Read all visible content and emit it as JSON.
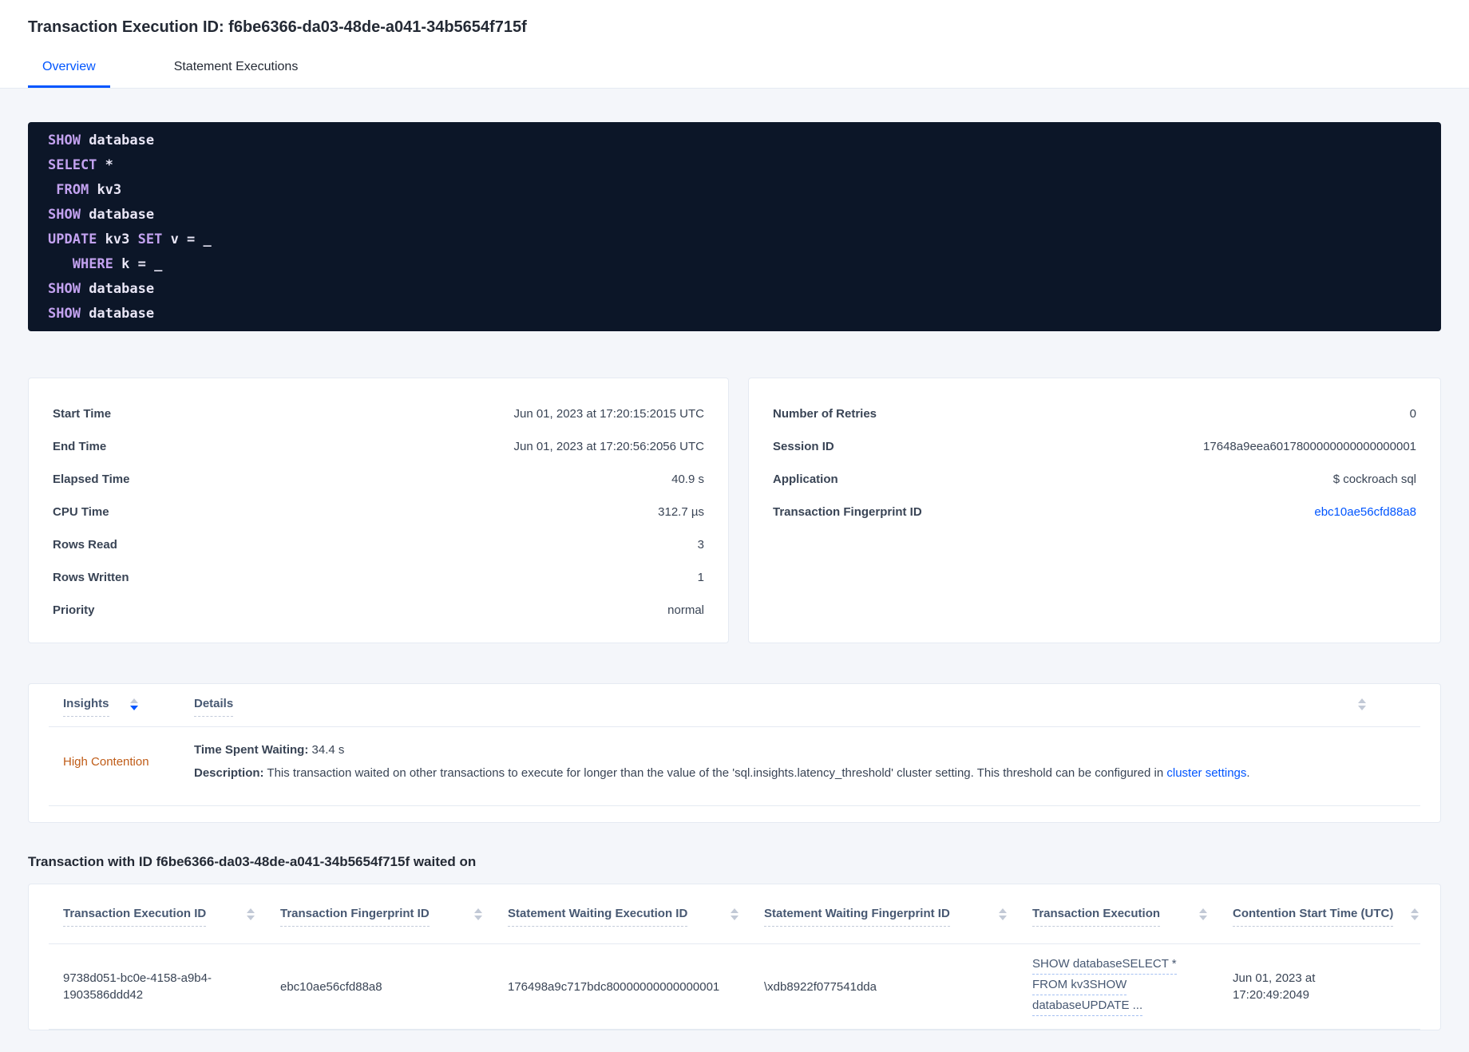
{
  "colors": {
    "accent": "#0055ff",
    "warning": "#bf5b16",
    "code_bg": "#0c1628",
    "kw": "#c3a2f0"
  },
  "page": {
    "title": "Transaction Execution ID: f6be6366-da03-48de-a041-34b5654f715f"
  },
  "tabs": [
    {
      "label": "Overview",
      "active": true
    },
    {
      "label": "Statement Executions",
      "active": false
    }
  ],
  "sql_box": {
    "lines": [
      [
        {
          "k": true,
          "t": "SHOW"
        },
        {
          "k": false,
          "t": " database"
        }
      ],
      [
        {
          "k": true,
          "t": "SELECT"
        },
        {
          "k": false,
          "t": " *"
        }
      ],
      [
        {
          "k": false,
          "t": " "
        },
        {
          "k": true,
          "t": "FROM"
        },
        {
          "k": false,
          "t": " kv3"
        }
      ],
      [
        {
          "k": true,
          "t": "SHOW"
        },
        {
          "k": false,
          "t": " database"
        }
      ],
      [
        {
          "k": true,
          "t": "UPDATE"
        },
        {
          "k": false,
          "t": " kv3 "
        },
        {
          "k": true,
          "t": "SET"
        },
        {
          "k": false,
          "t": " v = _"
        }
      ],
      [
        {
          "k": false,
          "t": "   "
        },
        {
          "k": true,
          "t": "WHERE"
        },
        {
          "k": false,
          "t": " k = _"
        }
      ],
      [
        {
          "k": true,
          "t": "SHOW"
        },
        {
          "k": false,
          "t": " database"
        }
      ],
      [
        {
          "k": true,
          "t": "SHOW"
        },
        {
          "k": false,
          "t": " database"
        }
      ]
    ]
  },
  "details_left": {
    "rows": [
      {
        "label": "Start Time",
        "value": "Jun 01, 2023 at 17:20:15:2015 UTC"
      },
      {
        "label": "End Time",
        "value": "Jun 01, 2023 at 17:20:56:2056 UTC"
      },
      {
        "label": "Elapsed Time",
        "value": "40.9 s"
      },
      {
        "label": "CPU Time",
        "value": "312.7 µs"
      },
      {
        "label": "Rows Read",
        "value": "3"
      },
      {
        "label": "Rows Written",
        "value": "1"
      },
      {
        "label": "Priority",
        "value": "normal"
      }
    ]
  },
  "details_right": {
    "rows": [
      {
        "label": "Number of Retries",
        "value": "0"
      },
      {
        "label": "Session ID",
        "value": "17648a9eea6017800000000000000001"
      },
      {
        "label": "Application",
        "value": "$ cockroach sql"
      },
      {
        "label": "Transaction Fingerprint ID",
        "value": "ebc10ae56cfd88a8",
        "link": true
      }
    ]
  },
  "insights": {
    "columns": [
      {
        "label": "Insights"
      },
      {
        "label": "Details"
      }
    ],
    "row": {
      "insight": "High Contention",
      "waiting_label": "Time Spent Waiting:",
      "waiting_value": " 34.4 s",
      "description_label": "Description:",
      "description_text": " This transaction waited on other transactions to execute for longer than the value of the 'sql.insights.latency_threshold' cluster setting. This threshold can be configured in ",
      "description_link": "cluster settings",
      "description_suffix": "."
    }
  },
  "waited_section": {
    "heading": "Transaction with ID f6be6366-da03-48de-a041-34b5654f715f waited on",
    "columns": [
      "Transaction Execution ID",
      "Transaction Fingerprint ID",
      "Statement Waiting Execution ID",
      "Statement Waiting Fingerprint ID",
      "Transaction Execution",
      "Contention Start Time (UTC)"
    ],
    "row": {
      "cells": [
        {
          "type": "text",
          "value": "9738d051-bc0e-4158-a9b4-1903586ddd42"
        },
        {
          "type": "text",
          "value": "ebc10ae56cfd88a8"
        },
        {
          "type": "text",
          "value": "176498a9c717bdc80000000000000001"
        },
        {
          "type": "text",
          "value": "\\xdb8922f077541dda"
        },
        {
          "type": "link-lines",
          "lines": [
            "SHOW databaseSELECT *",
            "FROM kv3SHOW",
            "databaseUPDATE ..."
          ]
        },
        {
          "type": "text",
          "value": "Jun 01, 2023 at 17:20:49:2049"
        }
      ]
    }
  }
}
